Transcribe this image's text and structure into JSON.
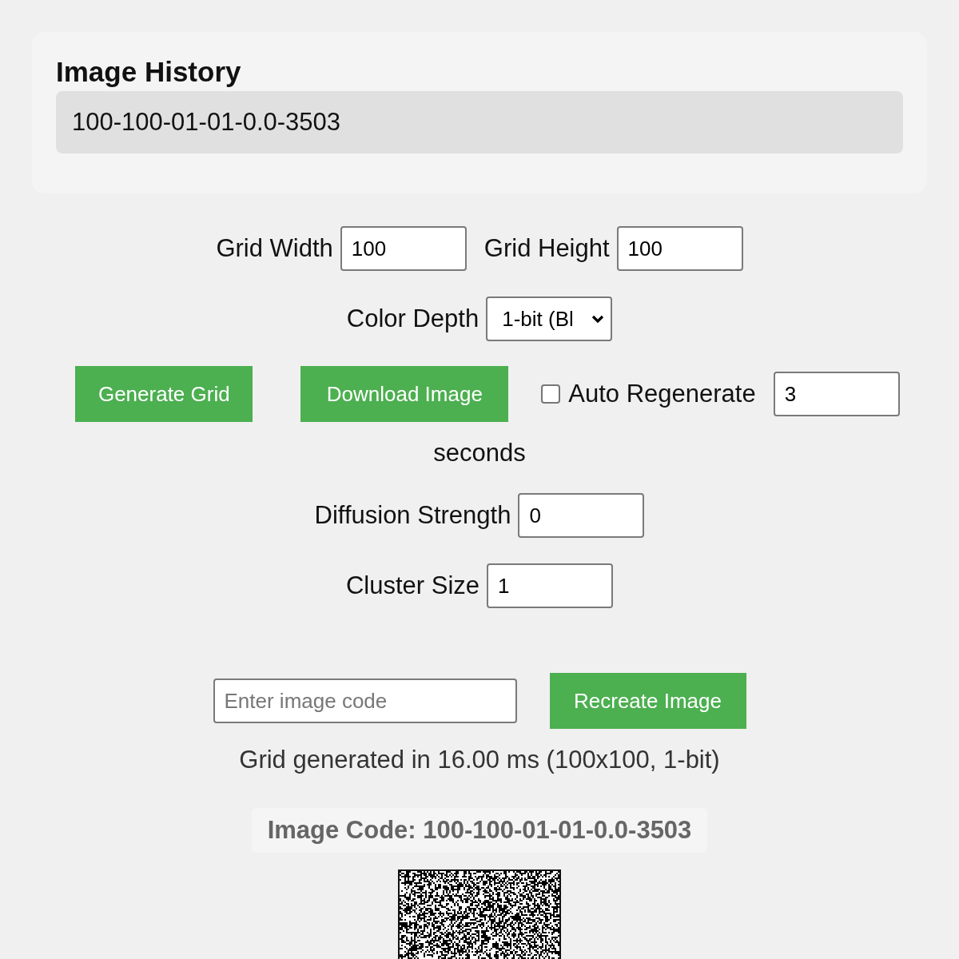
{
  "history": {
    "title": "Image History",
    "entries": [
      "100-100-01-01-0.0-3503"
    ]
  },
  "size_fields": [
    {
      "label": "Grid Width",
      "value": "100"
    },
    {
      "label": "Grid Height",
      "value": "100"
    }
  ],
  "color_depth": {
    "label": "Color Depth",
    "value": "1-bit (Bl"
  },
  "actions": [
    {
      "label": "Generate Grid"
    },
    {
      "label": "Download Image"
    }
  ],
  "auto_regenerate": {
    "label": "Auto Regenerate",
    "checked": false,
    "interval": "3",
    "unit": "seconds"
  },
  "effect_fields": [
    {
      "label": "Diffusion Strength",
      "value": "0"
    },
    {
      "label": "Cluster Size",
      "value": "1"
    }
  ],
  "recreate": {
    "placeholder": "Enter image code",
    "button": "Recreate Image"
  },
  "status": "Grid generated in 16.00 ms (100x100, 1-bit)",
  "image_code": "Image Code: 100-100-01-01-0.0-3503"
}
